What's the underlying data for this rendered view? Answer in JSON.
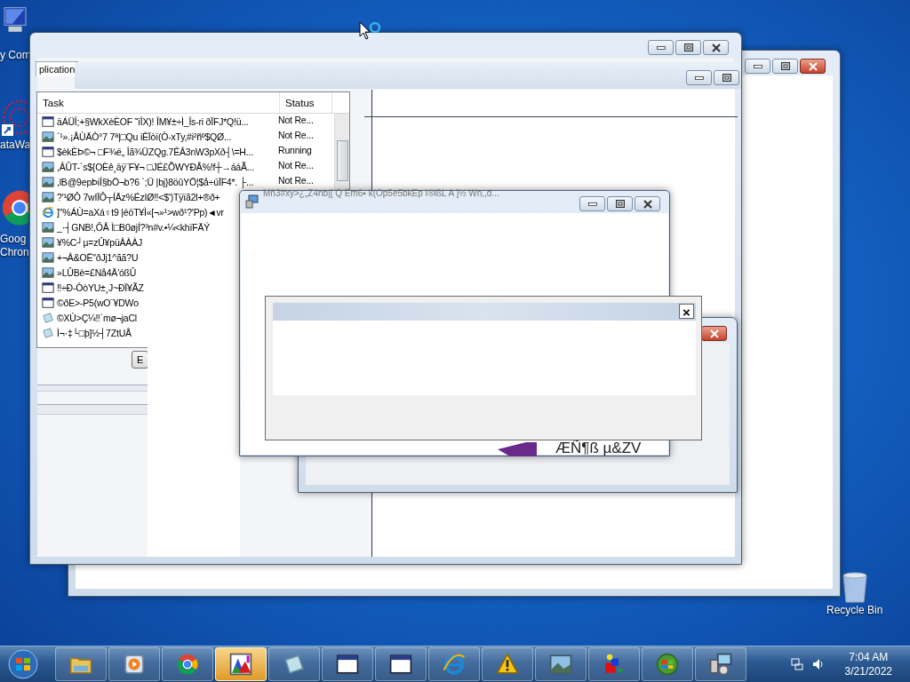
{
  "desktop_icons": [
    {
      "kind": "computer",
      "lines": [
        "y Com"
      ]
    },
    {
      "kind": "network-art",
      "lines": [
        "ataWa"
      ]
    },
    {
      "kind": "chrome",
      "lines": [
        "Goog",
        "Chron"
      ]
    }
  ],
  "recycle_bin": {
    "label": "Recycle Bin"
  },
  "back_window": {
    "active": true
  },
  "task_manager": {
    "tab": "plication",
    "columns": [
      "Task",
      "Status"
    ],
    "rows": [
      {
        "kind": "window",
        "task": "äÁÜÎ;+§WkXèÈOF ˜ïÎX)! ÎM¥±÷Ì_Îs-ri ðÏFJ*Q!ü...",
        "status": "Not Re..."
      },
      {
        "kind": "picture",
        "task": "´¹».¡ÅÙÄÒ°7 7ª|□Qu   iÊÏòï(Ò-xTy,#i²ñº$QØ...",
        "status": "Not Re..."
      },
      {
        "kind": "window",
        "task": "$èkÈÞ©¬ □F¾ë„ Îã¾ÜZQg.7ÊÂ3nW3pXð┤\\=H...",
        "status": "Running"
      },
      {
        "kind": "picture",
        "task": ",ÂÛT-`s${OÈê¸äÿ¨F¥¬ □JÉ£ÕWYÐÅ%!f┼→ááÃ...",
        "status": "Not Re..."
      },
      {
        "kind": "picture",
        "task": ",lB@9epÞiÎ§bÖ¬b?6 ´;Ü |bj}8öûYÖ¦$å÷úÏF4*. ├...",
        "status": "Not Re..."
      },
      {
        "kind": "picture",
        "task": "?'¹ØÔ 7wIÏÔ┬ÍÄz%ÉzIØ‼<$')Tÿïã2l+®ð+"
      },
      {
        "kind": "browser",
        "task": "]\"%ÁÙ=aXá♀t9 |éöT¥Ì«[¬»¹>wð¹?'Pp)◄vr"
      },
      {
        "kind": "picture",
        "task": "_·┤GNB!,ÔÅ Ì□B0øjÍ?³n#v.•¼<khïFÄÝ"
      },
      {
        "kind": "picture",
        "task": "¥%C┘µ=zÛ¥püÂÀÀJ"
      },
      {
        "kind": "picture",
        "task": "+¬Â&OË\"ðJj1^ãã?U"
      },
      {
        "kind": "picture",
        "task": "»LÛBè=£Nå4Ä'óßÛ"
      },
      {
        "kind": "window",
        "task": "‼÷Ð-ÒòYU±¸J~ÐÏ¥ÃZ"
      },
      {
        "kind": "window",
        "task": "©ðE>-P5(wO¨¥DWo"
      },
      {
        "kind": "notepad",
        "task": "©XÙ>Ç¼‼`mø¬jaCl"
      },
      {
        "kind": "notepad",
        "task": "Ì¬·‡└□þ]½┤7ZtUÅ"
      }
    ],
    "button": "E"
  },
  "small_window": {
    "active": true
  },
  "mid_window": {
    "title": "Mñ3#xy>¿„Z4nb|[ Q Em6▪ k(Op5e5bkEp I®lßL A ]½ Wn,,d...",
    "logo_text": "ÆÑ¶ß µ&ZV"
  },
  "dialog": {
    "close": "×"
  },
  "taskbar": {
    "items": [
      {
        "kind": "folder",
        "selected": false
      },
      {
        "kind": "media",
        "selected": false
      },
      {
        "kind": "chrome",
        "selected": false
      },
      {
        "kind": "chart",
        "selected": true
      },
      {
        "kind": "notepad",
        "selected": false
      },
      {
        "kind": "window",
        "selected": false
      },
      {
        "kind": "window",
        "selected": false
      },
      {
        "kind": "browser",
        "selected": false
      },
      {
        "kind": "warning",
        "selected": false
      },
      {
        "kind": "picture",
        "selected": false
      },
      {
        "kind": "shapes",
        "selected": false
      },
      {
        "kind": "orb",
        "selected": false
      },
      {
        "kind": "installer",
        "selected": false
      }
    ],
    "time": "7:04 AM",
    "date": "3/21/2022"
  }
}
